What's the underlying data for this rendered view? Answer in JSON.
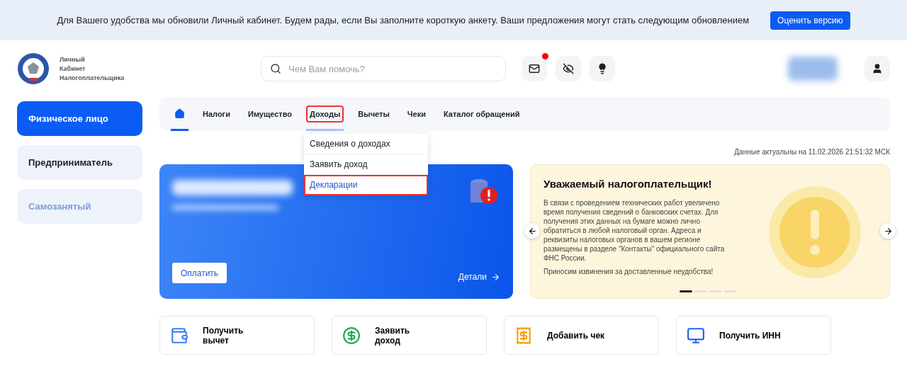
{
  "banner": {
    "text": "Для Вашего удобства мы обновили Личный кабинет. Будем рады, если Вы заполните короткую анкету. Ваши предложения могут стать следующим обновлением",
    "button": "Оценить версию"
  },
  "header": {
    "logo_lines": [
      "Личный",
      "Кабинет",
      "Налогоплательщика"
    ],
    "search": {
      "placeholder": "Чем Вам помочь?"
    },
    "actions": [
      {
        "kind": "mail",
        "badge": true
      },
      {
        "kind": "eye-off",
        "badge": false
      },
      {
        "kind": "bulb",
        "badge": false
      }
    ]
  },
  "sidebar": {
    "items": [
      {
        "label": "Физическое лицо",
        "selected": true,
        "disabled": false
      },
      {
        "label": "Предприниматель",
        "selected": false,
        "disabled": false
      },
      {
        "label": "Самозанятый",
        "selected": false,
        "disabled": true
      }
    ]
  },
  "nav": {
    "items": [
      {
        "kind": "home",
        "selected": true,
        "highlighted": false
      },
      {
        "kind": "text",
        "label": "Налоги",
        "selected": false,
        "highlighted": false
      },
      {
        "kind": "text",
        "label": "Имущество",
        "selected": false,
        "highlighted": false
      },
      {
        "kind": "text",
        "label": "Доходы",
        "selected": false,
        "highlighted": true,
        "expanded": true
      },
      {
        "kind": "text",
        "label": "Вычеты",
        "selected": false,
        "highlighted": false
      },
      {
        "kind": "text",
        "label": "Чеки",
        "selected": false,
        "highlighted": false
      },
      {
        "kind": "text",
        "label": "Каталог обращений",
        "selected": false,
        "highlighted": false
      }
    ],
    "dropdown": [
      {
        "label": "Сведения о доходах",
        "selected": false,
        "highlighted": false
      },
      {
        "label": "Заявить доход",
        "selected": false,
        "highlighted": false
      },
      {
        "label": "Декларации",
        "selected": true,
        "highlighted": true
      }
    ]
  },
  "updated": "Данные актуальны на 11.02.2026 21:51:32 МСК",
  "balance_card": {
    "pay_button": "Оплатить",
    "details_link": "Детали"
  },
  "notice": {
    "title": "Уважаемый налогоплательщик!",
    "paragraphs": [
      "В связи с проведением технических работ увеличено время получения сведений о банковских счетах. Для получения этих данных на бумаге можно лично обратиться в любой налоговый орган. Адреса и реквизиты налоговых органов в вашем регионе размещены в разделе \"Контакты\" официального сайта ФНС России.",
      "Приносим извинения за доставленные неудобства!"
    ],
    "dots": [
      {
        "selected": true
      },
      {
        "selected": false
      },
      {
        "selected": false
      },
      {
        "selected": false
      }
    ]
  },
  "quick_actions": [
    {
      "kind": "wallet",
      "label": "Получить вычет"
    },
    {
      "kind": "coin",
      "label": "Заявить доход"
    },
    {
      "kind": "receipt",
      "label": "Добавить чек"
    },
    {
      "kind": "monitor",
      "label": "Получить ИНН"
    }
  ]
}
